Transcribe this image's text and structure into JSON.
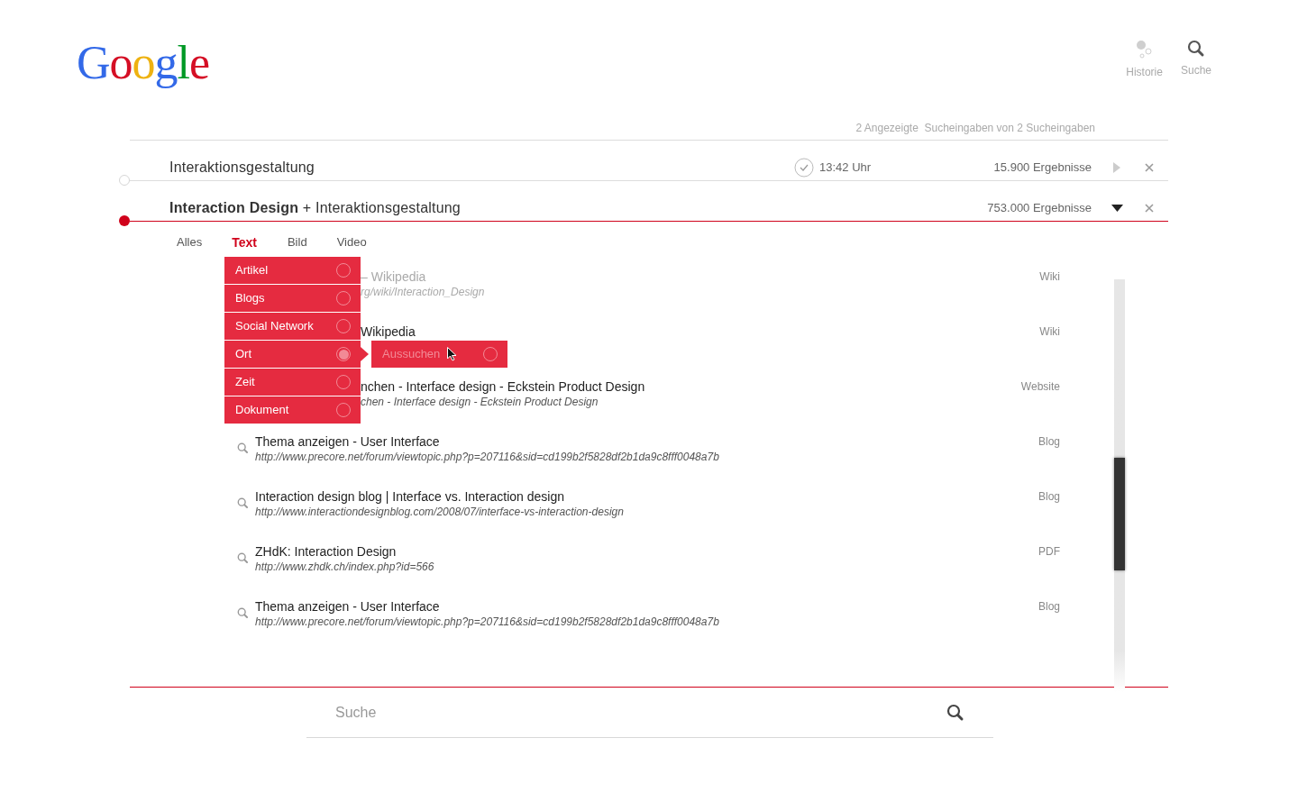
{
  "logo": "Google",
  "nav": [
    {
      "label": "Historie",
      "kind": "history"
    },
    {
      "label": "Suche",
      "kind": "search"
    }
  ],
  "summary": "2 Angezeigte  Sucheingaben von 2 Sucheingaben",
  "queries": [
    {
      "text": "Interaktionsgestaltung",
      "time": "13:42 Uhr",
      "results": "15.900 Ergebnisse",
      "selected": false,
      "expanded": false
    },
    {
      "text": "**Interaction Design** + Interaktionsgestaltung",
      "results": "753.000 Ergebnisse",
      "selected": true,
      "expanded": true
    }
  ],
  "tabs": [
    {
      "label": "Alles",
      "selected": false
    },
    {
      "label": "Text",
      "selected": true
    },
    {
      "label": "Bild",
      "selected": false
    },
    {
      "label": "Video",
      "selected": false
    }
  ],
  "filter_menu": [
    {
      "label": "Artikel",
      "selected": false
    },
    {
      "label": "Blogs",
      "selected": false
    },
    {
      "label": "Social Network",
      "selected": false
    },
    {
      "label": "Ort",
      "selected": true
    },
    {
      "label": "Zeit",
      "selected": false
    },
    {
      "label": "Dokument",
      "selected": false
    }
  ],
  "submenu": {
    "placeholder": "Aussuchen"
  },
  "results": [
    {
      "kind": "partial",
      "title": "– Wikipedia",
      "url": "rg/wiki/Interaction_Design",
      "type": "Wiki",
      "faded": true
    },
    {
      "kind": "partial",
      "title": "Wikipedia",
      "type": "Wiki",
      "faded": false
    },
    {
      "kind": "partial",
      "title": "nchen - Interface design - Eckstein Product Design",
      "url": "chen - Interface design - Eckstein Product Design",
      "type": "Website",
      "faded": false
    },
    {
      "kind": "full",
      "title": "Thema anzeigen - User Interface",
      "url": "http://www.precore.net/forum/viewtopic.php?p=207116&sid=cd199b2f5828df2b1da9c8fff0048a7b",
      "type": "Blog",
      "faded": false
    },
    {
      "kind": "full",
      "title": "Interaction design blog | Interface vs. Interaction design",
      "url": "http://www.interactiondesignblog.com/2008/07/interface-vs-interaction-design",
      "type": "Blog",
      "faded": false
    },
    {
      "kind": "full",
      "title": "ZHdK: Interaction Design",
      "url": "http://www.zhdk.ch/index.php?id=566",
      "type": "PDF",
      "faded": false
    },
    {
      "kind": "full",
      "title": "Thema anzeigen - User Interface",
      "url": "http://www.precore.net/forum/viewtopic.php?p=207116&sid=cd199b2f5828df2b1da9c8fff0048a7b",
      "type": "Blog",
      "faded": false
    }
  ],
  "search_field": {
    "placeholder": "Suche"
  }
}
